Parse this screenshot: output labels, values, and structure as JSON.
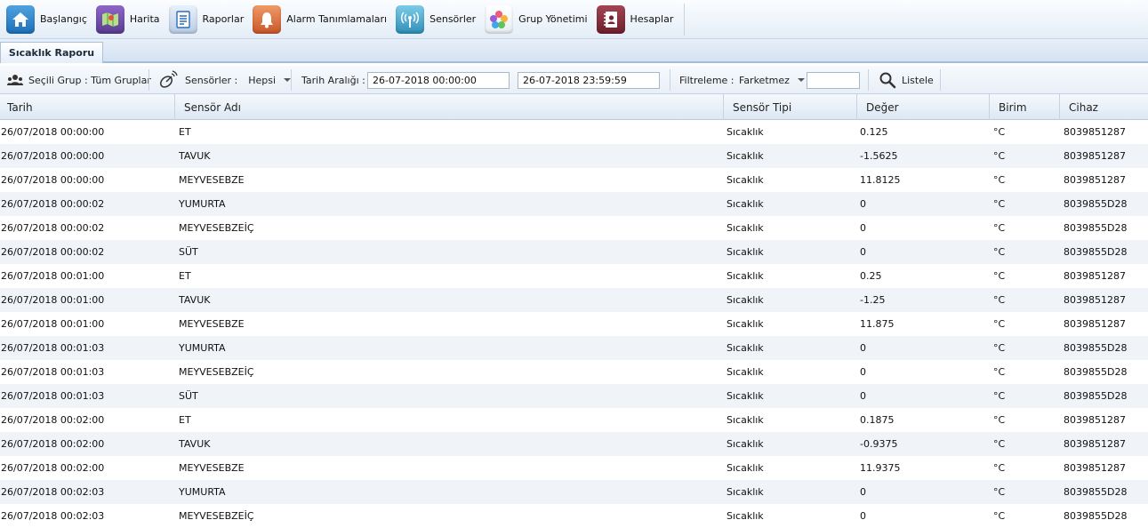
{
  "nav": {
    "home": "Başlangıç",
    "map": "Harita",
    "reports": "Raporlar",
    "alarms": "Alarm Tanımlamaları",
    "sensors": "Sensörler",
    "groups": "Grup Yönetimi",
    "accounts": "Hesaplar"
  },
  "tab": {
    "label": "Sıcaklık Raporu"
  },
  "filters": {
    "group_label": "Seçili Grup : Tüm Gruplar",
    "sensors_label": "Sensörler :",
    "sensors_value": "Hepsi",
    "date_range_label": "Tarih Aralığı :",
    "date_from": "26-07-2018 00:00:00",
    "date_to": "26-07-2018 23:59:59",
    "filter_label": "Filtreleme :",
    "filter_value": "Farketmez",
    "filter_text": "",
    "list_button": "Listele"
  },
  "table": {
    "columns": [
      "Tarih",
      "Sensör Adı",
      "Sensör Tipi",
      "Değer",
      "Birim",
      "Cihaz"
    ],
    "rows": [
      [
        "26/07/2018 00:00:00",
        "ET",
        "Sıcaklık",
        "0.125",
        "°C",
        "8039851287"
      ],
      [
        "26/07/2018 00:00:00",
        "TAVUK",
        "Sıcaklık",
        "-1.5625",
        "°C",
        "8039851287"
      ],
      [
        "26/07/2018 00:00:00",
        "MEYVESEBZE",
        "Sıcaklık",
        "11.8125",
        "°C",
        "8039851287"
      ],
      [
        "26/07/2018 00:00:02",
        "YUMURTA",
        "Sıcaklık",
        "0",
        "°C",
        "8039855D28"
      ],
      [
        "26/07/2018 00:00:02",
        "MEYVESEBZEİÇ",
        "Sıcaklık",
        "0",
        "°C",
        "8039855D28"
      ],
      [
        "26/07/2018 00:00:02",
        "SÜT",
        "Sıcaklık",
        "0",
        "°C",
        "8039855D28"
      ],
      [
        "26/07/2018 00:01:00",
        "ET",
        "Sıcaklık",
        "0.25",
        "°C",
        "8039851287"
      ],
      [
        "26/07/2018 00:01:00",
        "TAVUK",
        "Sıcaklık",
        "-1.25",
        "°C",
        "8039851287"
      ],
      [
        "26/07/2018 00:01:00",
        "MEYVESEBZE",
        "Sıcaklık",
        "11.875",
        "°C",
        "8039851287"
      ],
      [
        "26/07/2018 00:01:03",
        "YUMURTA",
        "Sıcaklık",
        "0",
        "°C",
        "8039855D28"
      ],
      [
        "26/07/2018 00:01:03",
        "MEYVESEBZEİÇ",
        "Sıcaklık",
        "0",
        "°C",
        "8039855D28"
      ],
      [
        "26/07/2018 00:01:03",
        "SÜT",
        "Sıcaklık",
        "0",
        "°C",
        "8039855D28"
      ],
      [
        "26/07/2018 00:02:00",
        "ET",
        "Sıcaklık",
        "0.1875",
        "°C",
        "8039851287"
      ],
      [
        "26/07/2018 00:02:00",
        "TAVUK",
        "Sıcaklık",
        "-0.9375",
        "°C",
        "8039851287"
      ],
      [
        "26/07/2018 00:02:00",
        "MEYVESEBZE",
        "Sıcaklık",
        "11.9375",
        "°C",
        "8039851287"
      ],
      [
        "26/07/2018 00:02:03",
        "YUMURTA",
        "Sıcaklık",
        "0",
        "°C",
        "8039855D28"
      ],
      [
        "26/07/2018 00:02:03",
        "MEYVESEBZEİÇ",
        "Sıcaklık",
        "0",
        "°C",
        "8039855D28"
      ]
    ]
  }
}
